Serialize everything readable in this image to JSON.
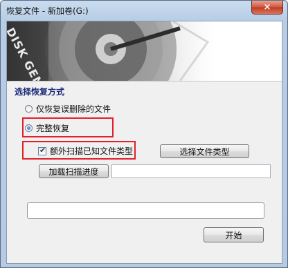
{
  "window": {
    "title": "恢复文件 - 新加卷(G:)",
    "close_icon": "×"
  },
  "banner": {
    "logo_text": "DISK GENIUS"
  },
  "recovery": {
    "section_title": "选择恢复方式",
    "options": [
      {
        "label": "仅恢复误删除的文件",
        "checked": false
      },
      {
        "label": "完整恢复",
        "checked": true
      }
    ],
    "extra_scan_label": "额外扫描已知文件类型",
    "extra_scan_checked": true,
    "select_types_button": "选择文件类型",
    "load_progress_button": "加载扫描进度",
    "load_progress_value": "",
    "progress_value": 0,
    "start_button": "开始"
  }
}
